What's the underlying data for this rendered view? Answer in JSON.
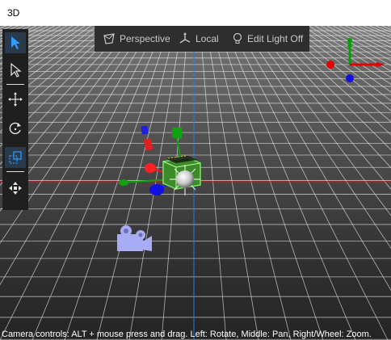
{
  "window": {
    "title": "3D"
  },
  "toolbar": {
    "items": [
      {
        "name": "select-tool",
        "active": true
      },
      {
        "name": "select-subitem-tool",
        "active": false
      },
      {
        "name": "move-tool",
        "active": false
      },
      {
        "name": "rotate-tool",
        "active": false
      },
      {
        "name": "scale-tool",
        "active": true
      },
      {
        "name": "fit-view-tool",
        "active": false
      }
    ]
  },
  "view_bar": {
    "perspective_label": "Perspective",
    "local_label": "Local",
    "edit_light_label": "Edit Light Off"
  },
  "status": {
    "text": "Camera controls: ALT + mouse press and drag. Left: Rotate, Middle: Pan, Right/Wheel: Zoom."
  },
  "colors": {
    "x_axis": "#e00000",
    "y_axis": "#00a000",
    "z_axis": "#0000e0",
    "grid": "#ffffff",
    "selection": "#5cd33a",
    "camera": "#a7acf4"
  }
}
